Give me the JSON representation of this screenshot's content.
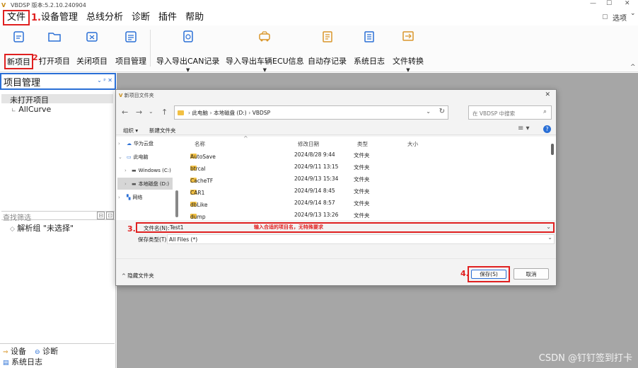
{
  "window": {
    "title": "VBDSP 版本:5.2.10.240904",
    "min": "—",
    "max": "☐",
    "close": "✕"
  },
  "menu": {
    "items": [
      "文件",
      "设备管理",
      "总线分析",
      "诊断",
      "插件",
      "帮助"
    ],
    "step1": "1.",
    "options": "选项",
    "options_caret": "⌄"
  },
  "ribbon": {
    "buttons": [
      {
        "label": "新项目",
        "icon": "new-project-icon"
      },
      {
        "label": "打开项目",
        "icon": "open-folder-icon"
      },
      {
        "label": "关闭项目",
        "icon": "close-project-icon"
      },
      {
        "label": "项目管理",
        "icon": "project-manage-icon"
      },
      {
        "label": "导入导出CAN记录",
        "icon": "can-record-icon"
      },
      {
        "label": "导入导出车辆ECU信息",
        "icon": "vehicle-ecu-icon"
      },
      {
        "label": "自动存记录",
        "icon": "autosave-icon"
      },
      {
        "label": "系统日志",
        "icon": "system-log-icon"
      },
      {
        "label": "文件转换",
        "icon": "file-convert-icon"
      }
    ],
    "step2": "2."
  },
  "left_panel": {
    "title": "项目管理",
    "title_controls": "⌄ ᵖ ✕",
    "tree": [
      "未打开项目",
      "AllCurve"
    ],
    "filter_placeholder": "查找筛选",
    "parse_group": "解析组 \"未选择\"",
    "bottom_tabs": [
      "设备",
      "诊断"
    ],
    "syslog": "系统日志"
  },
  "dialog": {
    "title": "新项目文件夹",
    "close": "✕",
    "breadcrumb": [
      "此电脑",
      "本地磁盘 (D:)",
      "VBDSP"
    ],
    "search_placeholder": "在 VBDSP 中搜索",
    "toolbar": {
      "organize": "组织 ▾",
      "new_folder": "新建文件夹"
    },
    "nav": [
      "华为云盘",
      "此电脑",
      "Windows (C:)",
      "本地磁盘 (D:)",
      "网络"
    ],
    "columns": [
      "名称",
      "修改日期",
      "类型",
      "大小"
    ],
    "files": [
      {
        "name": "AutoSave",
        "date": "2024/8/28 9:44",
        "type": "文件夹"
      },
      {
        "name": "btrcal",
        "date": "2024/9/11 13:15",
        "type": "文件夹"
      },
      {
        "name": "CacheTF",
        "date": "2024/9/13 15:34",
        "type": "文件夹"
      },
      {
        "name": "CAR1",
        "date": "2024/9/14 8:45",
        "type": "文件夹"
      },
      {
        "name": "dbLike",
        "date": "2024/9/14 8:57",
        "type": "文件夹"
      },
      {
        "name": "dump",
        "date": "2024/9/13 13:26",
        "type": "文件夹"
      }
    ],
    "filename_label": "文件名(N):",
    "filename_value": "Test1",
    "filename_hint": "输入合适的项目名，无特殊要求",
    "step3": "3.",
    "savetype_label": "保存类型(T):",
    "savetype_value": "All Files (*)",
    "hide_folders": "隐藏文件夹",
    "save": "保存(S)",
    "cancel": "取消",
    "step4": "4."
  },
  "watermark": "CSDN @钉钉签到打卡",
  "colors": {
    "accent_red": "#e02020",
    "selection_blue": "#2a6fd6",
    "folder_yellow": "#f2c043",
    "workspace_gray": "#a6a6a6"
  }
}
